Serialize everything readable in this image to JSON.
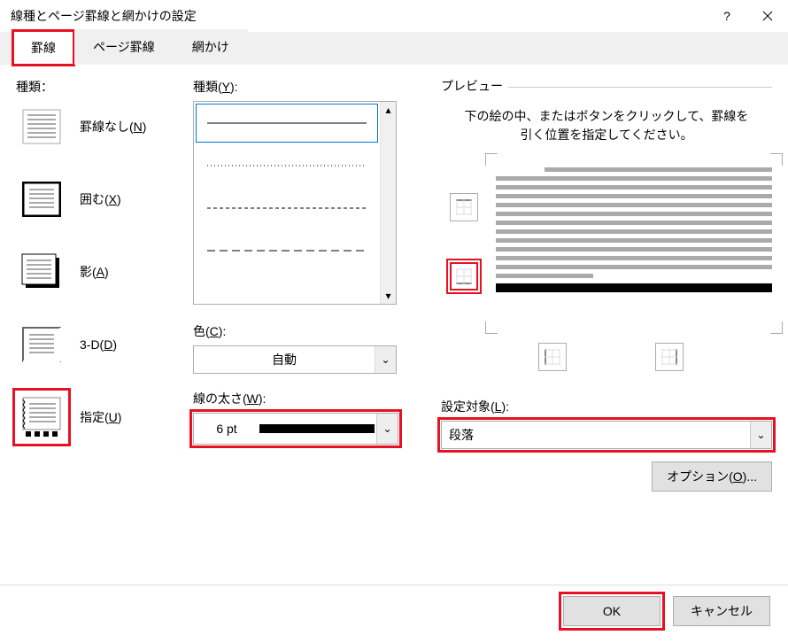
{
  "title": "線種とページ罫線と網かけの設定",
  "tabs": {
    "borders": "罫線",
    "page_borders": "ページ罫線",
    "shading": "網かけ"
  },
  "left": {
    "header": "種類：",
    "items": {
      "none": "罫線なし(N)",
      "box": "囲む(X)",
      "shadow": "影(A)",
      "threeD": "3-D(D)",
      "custom": "指定(U)"
    }
  },
  "mid": {
    "style_label": "種類(Y):",
    "color_label": "色(C):",
    "color_value": "自動",
    "width_label": "線の太さ(W):",
    "width_value": "6 pt"
  },
  "right": {
    "preview_label": "プレビュー",
    "preview_desc": "下の絵の中、またはボタンをクリックして、罫線を引く位置を指定してください。",
    "apply_label": "設定対象(L):",
    "apply_value": "段落",
    "options_btn": "オプション(O)..."
  },
  "footer": {
    "ok": "OK",
    "cancel": "キャンセル"
  }
}
